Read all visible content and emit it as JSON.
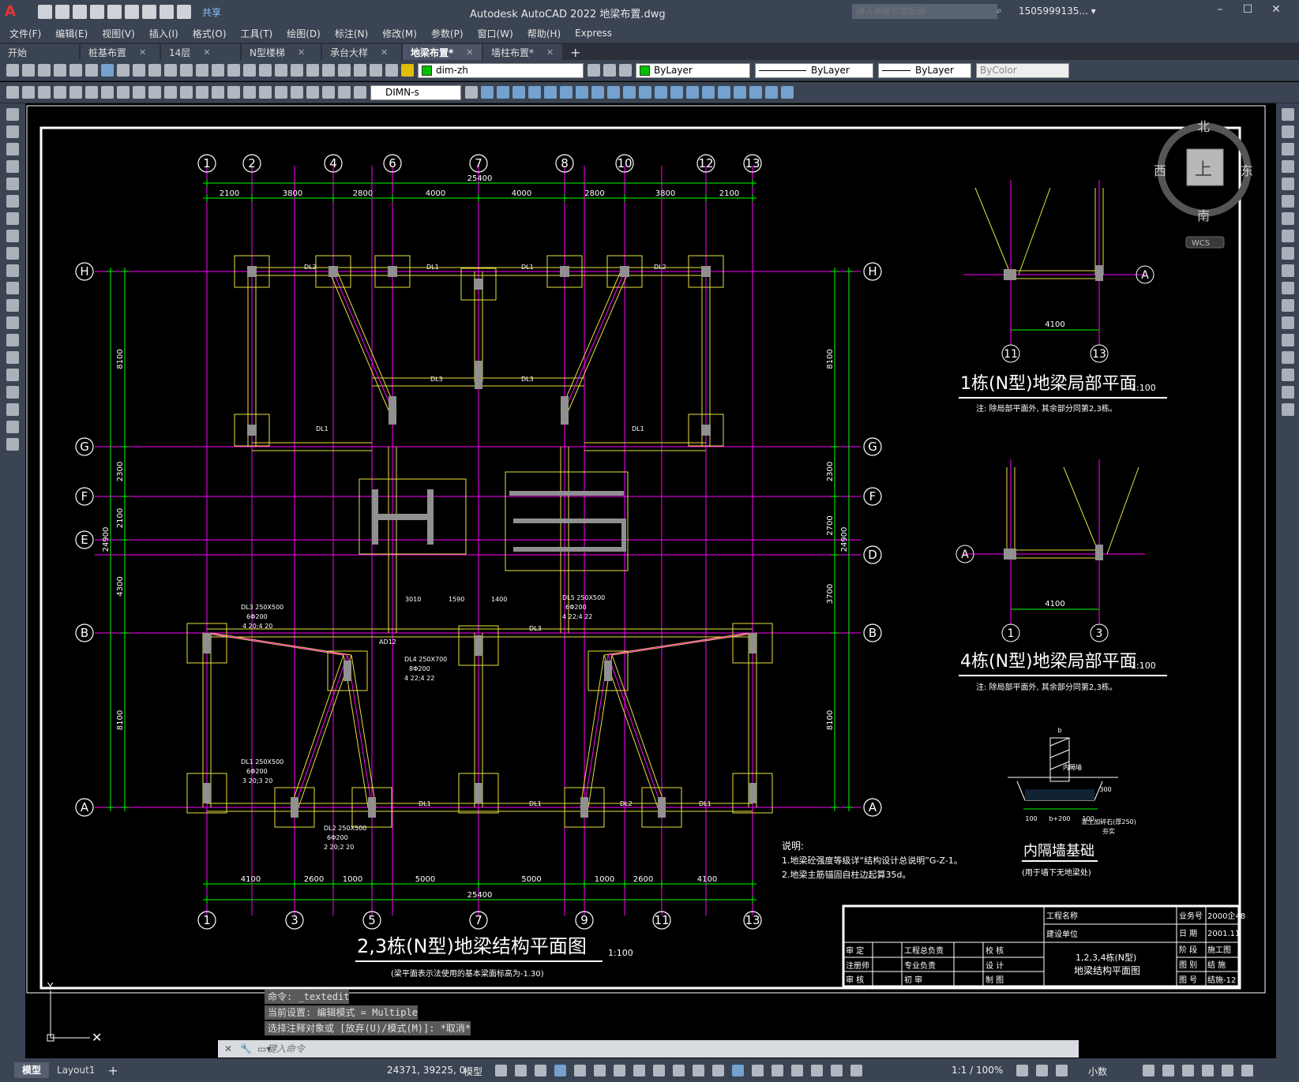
{
  "app": {
    "title": "Autodesk AutoCAD 2022    地梁布置.dwg",
    "logo": "A",
    "search_placeholder": "键入关键字或短语",
    "user": "1505999135... ▾",
    "share": "共享"
  },
  "menu": [
    "文件(F)",
    "编辑(E)",
    "视图(V)",
    "插入(I)",
    "格式(O)",
    "工具(T)",
    "绘图(D)",
    "标注(N)",
    "修改(M)",
    "参数(P)",
    "窗口(W)",
    "帮助(H)",
    "Express"
  ],
  "tabs": [
    {
      "label": "开始",
      "closable": false
    },
    {
      "label": "桩基布置",
      "closable": true
    },
    {
      "label": "14层",
      "closable": true
    },
    {
      "label": "N型楼梯",
      "closable": true
    },
    {
      "label": "承台大样",
      "closable": true
    },
    {
      "label": "地梁布置*",
      "closable": true,
      "active": true
    },
    {
      "label": "墙柱布置*",
      "closable": true
    }
  ],
  "toolbar": {
    "layer": "dim-zh",
    "color": "ByLayer",
    "linetype": "ByLayer",
    "lineweight": "ByLayer",
    "plotstyle": "ByColor",
    "dimstyle": "DIMN-s"
  },
  "viewcube": {
    "north": "北",
    "south": "南",
    "west": "西",
    "east": "东",
    "top": "上",
    "wcs": "WCS"
  },
  "drawing": {
    "main_title": "2,3栋(N型)地梁结构平面图",
    "main_scale": "1:100",
    "main_note": "(梁平面表示法使用的基本梁面标高为-1.30)",
    "top_axes": [
      "1",
      "2",
      "4",
      "6",
      "7",
      "8",
      "10",
      "12",
      "13"
    ],
    "bottom_axes": [
      "1",
      "3",
      "5",
      "7",
      "9",
      "11",
      "13"
    ],
    "left_axes": [
      "H",
      "G",
      "F",
      "E",
      "B",
      "A"
    ],
    "right_axes": [
      "H",
      "G",
      "F",
      "D",
      "B",
      "A"
    ],
    "top_total": "25400",
    "top_dims": [
      "2100",
      "3800",
      "2800",
      "4000",
      "4000",
      "2800",
      "3800",
      "2100"
    ],
    "bottom_total": "25400",
    "bottom_dims": [
      "4100",
      "2600",
      "1000",
      "5000",
      "5000",
      "1000",
      "2600",
      "4100"
    ],
    "left_total": "24900",
    "left_dims": [
      "8100",
      "2300",
      "2100",
      "4300",
      "8100"
    ],
    "right_total": "24900",
    "right_dims": [
      "8100",
      "2300",
      "2700",
      "3700",
      "8100"
    ],
    "beam_labels": [
      "DL1",
      "DL2",
      "DL3",
      "DL4",
      "DL5"
    ],
    "annotations": [
      "DL3 250X500",
      "6Φ200",
      "4 20;4 20",
      "DL4 250X700",
      "8Φ200",
      "4 22;4 22",
      "DL5 250X500",
      "6Φ200",
      "4 22;4 22",
      "DL1 250X500",
      "6Φ200",
      "3 20;3 20",
      "DL2 250X500",
      "6Φ200",
      "2 20;2 20",
      "1590",
      "1400",
      "3010",
      "AD12"
    ],
    "detail1": {
      "title": "1栋(N型)地梁局部平面",
      "scale": "1:100",
      "note": "注: 除局部平面外, 其余部分同第2,3栋。",
      "dim": "4100",
      "axes": [
        "11",
        "13"
      ],
      "row": "A"
    },
    "detail2": {
      "title": "4栋(N型)地梁局部平面",
      "scale": "1:100",
      "note": "注: 除局部平面外, 其余部分同第2,3栋。",
      "dim": "4100",
      "axes": [
        "1",
        "3"
      ],
      "row": "A"
    },
    "detail3": {
      "title": "内隔墙基础",
      "note": "(用于墙下无地梁处)",
      "labels": [
        "b",
        "内隔墙",
        "300",
        "100",
        "b+200",
        "100",
        "混土加碎石(厚250)",
        "夯实"
      ]
    },
    "notes": {
      "heading": "说明:",
      "lines": [
        "1.地梁砼强度等级详“结构设计总说明”G-Z-1。",
        "2.地梁主筋锚固自柱边起算35d。"
      ]
    },
    "titleblock": {
      "project_name": "工程名称",
      "build_unit": "建设单位",
      "job_no_label": "业务号",
      "job_no": "2000企48",
      "date_label": "日  期",
      "date": "2001.11",
      "stage_label": "阶  段",
      "stage": "施工图",
      "cat_label": "图  别",
      "cat": "结  施",
      "dwg_label": "图  号",
      "dwg": "结施-12",
      "sheet_title_1": "1,2,3,4栋(N型)",
      "sheet_title_2": "地梁结构平面图",
      "roles": [
        [
          "审 定",
          "工程总负责",
          "校 核"
        ],
        [
          "注册师",
          "专业负责",
          "设 计"
        ],
        [
          "审 核",
          "初  审",
          "制 图"
        ]
      ]
    }
  },
  "command": {
    "history": [
      "命令: _textedit",
      "当前设置: 编辑模式 = Multiple",
      "选择注释对象或 [放弃(U)/模式(M)]: *取消*"
    ],
    "placeholder": "键入命令"
  },
  "status": {
    "layout_tabs": [
      "模型",
      "Layout1"
    ],
    "coords": "24371, 39225, 0",
    "model": "模型",
    "scale": "1:1 / 100%",
    "units": "小数"
  },
  "colors": {
    "ui": "#3b4453",
    "canvas": "#000000",
    "beam": "#e8e040",
    "axis": "#ff00ff",
    "dim": "#00ff00",
    "column": "#909090"
  }
}
